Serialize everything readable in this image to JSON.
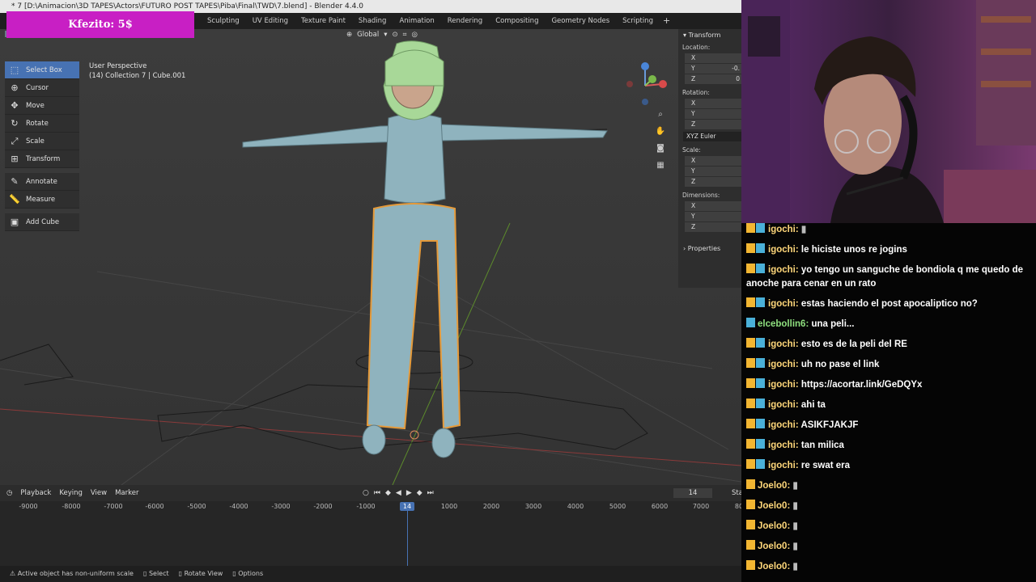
{
  "blender": {
    "window_title": "* 7 [D:\\Animacion\\3D TAPES\\Actors\\FUTURO POST TAPES\\Piba\\Final\\TWD\\7.blend] - Blender 4.4.0",
    "workspace_tabs": [
      "Sculpting",
      "UV Editing",
      "Texture Paint",
      "Shading",
      "Animation",
      "Rendering",
      "Compositing",
      "Geometry Nodes",
      "Scripting"
    ],
    "add_tab_symbol": "+",
    "orientation": "Global",
    "tools": [
      {
        "label": "Select Box",
        "icon": "select-box-icon",
        "active": true
      },
      {
        "label": "Cursor",
        "icon": "cursor-icon",
        "active": false
      },
      {
        "label": "Move",
        "icon": "move-icon",
        "active": false
      },
      {
        "label": "Rotate",
        "icon": "rotate-icon",
        "active": false
      },
      {
        "label": "Scale",
        "icon": "scale-icon",
        "active": false
      },
      {
        "label": "Transform",
        "icon": "transform-icon",
        "active": false
      },
      {
        "label": "Annotate",
        "icon": "annotate-icon",
        "active": false
      },
      {
        "label": "Measure",
        "icon": "measure-icon",
        "active": false
      },
      {
        "label": "Add Cube",
        "icon": "add-cube-icon",
        "active": false
      }
    ],
    "viewport_info": {
      "view_name": "User Perspective",
      "collection": "(14) Collection 7 | Cube.001"
    },
    "transform_panel": {
      "title": "Transform",
      "location_label": "Location:",
      "location": {
        "x": "",
        "y": "-0.",
        "z": "0"
      },
      "rotation_label": "Rotation:",
      "rotation_mode": "XYZ Euler",
      "scale_label": "Scale:",
      "dimensions_label": "Dimensions:",
      "axes": [
        "X",
        "Y",
        "Z"
      ],
      "properties_label": "Properties"
    },
    "timeline": {
      "menus": [
        "Playback",
        "Keying",
        "View",
        "Marker"
      ],
      "current_frame": "14",
      "ticks": [
        "-9000",
        "-8000",
        "-7000",
        "-6000",
        "-5000",
        "-4000",
        "-3000",
        "-2000",
        "-1000",
        "14",
        "1000",
        "2000",
        "3000",
        "4000",
        "5000",
        "6000",
        "7000",
        "80"
      ],
      "start_label": "Sta"
    },
    "status_bar": [
      "Active object has non-uniform scale",
      "Select",
      "Rotate View",
      "Options"
    ]
  },
  "donation": {
    "text": "Kfezito: 5$"
  },
  "chat": [
    {
      "user": "igochi",
      "message": "",
      "style": "user-igochi",
      "badges": [
        "crown",
        "wing"
      ]
    },
    {
      "user": "igochi",
      "message": "le hiciste unos re jogins",
      "style": "user-igochi",
      "badges": [
        "crown",
        "wing"
      ]
    },
    {
      "user": "igochi",
      "message": "yo tengo un sanguche de bondiola q me quedo de anoche para cenar en un rato",
      "style": "user-igochi",
      "badges": [
        "crown",
        "wing"
      ]
    },
    {
      "user": "igochi",
      "message": "estas haciendo el post apocaliptico no?",
      "style": "user-igochi",
      "badges": [
        "crown",
        "wing"
      ]
    },
    {
      "user": "elcebollin6",
      "message": "una peli...",
      "style": "user-elce",
      "badges": [
        "wing"
      ]
    },
    {
      "user": "igochi",
      "message": "esto es de la peli del RE",
      "style": "user-igochi",
      "badges": [
        "crown",
        "wing"
      ]
    },
    {
      "user": "igochi",
      "message": "uh no pase el link",
      "style": "user-igochi",
      "badges": [
        "crown",
        "wing"
      ]
    },
    {
      "user": "igochi",
      "message": "https://acortar.link/GeDQYx",
      "style": "user-igochi",
      "badges": [
        "crown",
        "wing"
      ]
    },
    {
      "user": "igochi",
      "message": "ahi ta",
      "style": "user-igochi",
      "badges": [
        "crown",
        "wing"
      ]
    },
    {
      "user": "igochi",
      "message": "ASIKFJAKJF",
      "style": "user-igochi",
      "badges": [
        "crown",
        "wing"
      ]
    },
    {
      "user": "igochi",
      "message": "tan milica",
      "style": "user-igochi",
      "badges": [
        "crown",
        "wing"
      ]
    },
    {
      "user": "igochi",
      "message": "re swat era",
      "style": "user-igochi",
      "badges": [
        "crown",
        "wing"
      ]
    },
    {
      "user": "Joelo0",
      "message": "",
      "style": "user-joelo",
      "badges": [
        "crown"
      ]
    },
    {
      "user": "Joelo0",
      "message": "",
      "style": "user-joelo",
      "badges": [
        "crown"
      ]
    },
    {
      "user": "Joelo0",
      "message": "",
      "style": "user-joelo",
      "badges": [
        "crown"
      ]
    },
    {
      "user": "Joelo0",
      "message": "",
      "style": "user-joelo",
      "badges": [
        "crown"
      ]
    },
    {
      "user": "Joelo0",
      "message": "",
      "style": "user-joelo",
      "badges": [
        "crown"
      ]
    }
  ],
  "colors": {
    "accent": "#4772b3",
    "donation_bg": "#c81fc4",
    "username": "#ffd77a"
  }
}
